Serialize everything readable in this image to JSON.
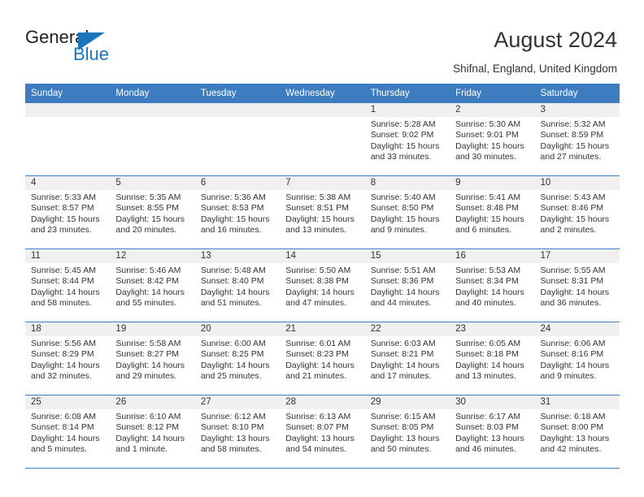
{
  "brand": {
    "name_part1": "General",
    "name_part2": "Blue"
  },
  "header": {
    "title": "August 2024",
    "location": "Shifnal, England, United Kingdom"
  },
  "colors": {
    "header_blue": "#3c7cbf",
    "brand_blue": "#1b75bb",
    "daynum_bg": "#f0f0f0",
    "text": "#333333"
  },
  "weekday_headers": [
    "Sunday",
    "Monday",
    "Tuesday",
    "Wednesday",
    "Thursday",
    "Friday",
    "Saturday"
  ],
  "weeks": [
    [
      {
        "day": "",
        "empty": true
      },
      {
        "day": "",
        "empty": true
      },
      {
        "day": "",
        "empty": true
      },
      {
        "day": "",
        "empty": true
      },
      {
        "day": "1",
        "sunrise": "Sunrise: 5:28 AM",
        "sunset": "Sunset: 9:02 PM",
        "daylight1": "Daylight: 15 hours",
        "daylight2": "and 33 minutes."
      },
      {
        "day": "2",
        "sunrise": "Sunrise: 5:30 AM",
        "sunset": "Sunset: 9:01 PM",
        "daylight1": "Daylight: 15 hours",
        "daylight2": "and 30 minutes."
      },
      {
        "day": "3",
        "sunrise": "Sunrise: 5:32 AM",
        "sunset": "Sunset: 8:59 PM",
        "daylight1": "Daylight: 15 hours",
        "daylight2": "and 27 minutes."
      }
    ],
    [
      {
        "day": "4",
        "sunrise": "Sunrise: 5:33 AM",
        "sunset": "Sunset: 8:57 PM",
        "daylight1": "Daylight: 15 hours",
        "daylight2": "and 23 minutes."
      },
      {
        "day": "5",
        "sunrise": "Sunrise: 5:35 AM",
        "sunset": "Sunset: 8:55 PM",
        "daylight1": "Daylight: 15 hours",
        "daylight2": "and 20 minutes."
      },
      {
        "day": "6",
        "sunrise": "Sunrise: 5:36 AM",
        "sunset": "Sunset: 8:53 PM",
        "daylight1": "Daylight: 15 hours",
        "daylight2": "and 16 minutes."
      },
      {
        "day": "7",
        "sunrise": "Sunrise: 5:38 AM",
        "sunset": "Sunset: 8:51 PM",
        "daylight1": "Daylight: 15 hours",
        "daylight2": "and 13 minutes."
      },
      {
        "day": "8",
        "sunrise": "Sunrise: 5:40 AM",
        "sunset": "Sunset: 8:50 PM",
        "daylight1": "Daylight: 15 hours",
        "daylight2": "and 9 minutes."
      },
      {
        "day": "9",
        "sunrise": "Sunrise: 5:41 AM",
        "sunset": "Sunset: 8:48 PM",
        "daylight1": "Daylight: 15 hours",
        "daylight2": "and 6 minutes."
      },
      {
        "day": "10",
        "sunrise": "Sunrise: 5:43 AM",
        "sunset": "Sunset: 8:46 PM",
        "daylight1": "Daylight: 15 hours",
        "daylight2": "and 2 minutes."
      }
    ],
    [
      {
        "day": "11",
        "sunrise": "Sunrise: 5:45 AM",
        "sunset": "Sunset: 8:44 PM",
        "daylight1": "Daylight: 14 hours",
        "daylight2": "and 58 minutes."
      },
      {
        "day": "12",
        "sunrise": "Sunrise: 5:46 AM",
        "sunset": "Sunset: 8:42 PM",
        "daylight1": "Daylight: 14 hours",
        "daylight2": "and 55 minutes."
      },
      {
        "day": "13",
        "sunrise": "Sunrise: 5:48 AM",
        "sunset": "Sunset: 8:40 PM",
        "daylight1": "Daylight: 14 hours",
        "daylight2": "and 51 minutes."
      },
      {
        "day": "14",
        "sunrise": "Sunrise: 5:50 AM",
        "sunset": "Sunset: 8:38 PM",
        "daylight1": "Daylight: 14 hours",
        "daylight2": "and 47 minutes."
      },
      {
        "day": "15",
        "sunrise": "Sunrise: 5:51 AM",
        "sunset": "Sunset: 8:36 PM",
        "daylight1": "Daylight: 14 hours",
        "daylight2": "and 44 minutes."
      },
      {
        "day": "16",
        "sunrise": "Sunrise: 5:53 AM",
        "sunset": "Sunset: 8:34 PM",
        "daylight1": "Daylight: 14 hours",
        "daylight2": "and 40 minutes."
      },
      {
        "day": "17",
        "sunrise": "Sunrise: 5:55 AM",
        "sunset": "Sunset: 8:31 PM",
        "daylight1": "Daylight: 14 hours",
        "daylight2": "and 36 minutes."
      }
    ],
    [
      {
        "day": "18",
        "sunrise": "Sunrise: 5:56 AM",
        "sunset": "Sunset: 8:29 PM",
        "daylight1": "Daylight: 14 hours",
        "daylight2": "and 32 minutes."
      },
      {
        "day": "19",
        "sunrise": "Sunrise: 5:58 AM",
        "sunset": "Sunset: 8:27 PM",
        "daylight1": "Daylight: 14 hours",
        "daylight2": "and 29 minutes."
      },
      {
        "day": "20",
        "sunrise": "Sunrise: 6:00 AM",
        "sunset": "Sunset: 8:25 PM",
        "daylight1": "Daylight: 14 hours",
        "daylight2": "and 25 minutes."
      },
      {
        "day": "21",
        "sunrise": "Sunrise: 6:01 AM",
        "sunset": "Sunset: 8:23 PM",
        "daylight1": "Daylight: 14 hours",
        "daylight2": "and 21 minutes."
      },
      {
        "day": "22",
        "sunrise": "Sunrise: 6:03 AM",
        "sunset": "Sunset: 8:21 PM",
        "daylight1": "Daylight: 14 hours",
        "daylight2": "and 17 minutes."
      },
      {
        "day": "23",
        "sunrise": "Sunrise: 6:05 AM",
        "sunset": "Sunset: 8:18 PM",
        "daylight1": "Daylight: 14 hours",
        "daylight2": "and 13 minutes."
      },
      {
        "day": "24",
        "sunrise": "Sunrise: 6:06 AM",
        "sunset": "Sunset: 8:16 PM",
        "daylight1": "Daylight: 14 hours",
        "daylight2": "and 9 minutes."
      }
    ],
    [
      {
        "day": "25",
        "sunrise": "Sunrise: 6:08 AM",
        "sunset": "Sunset: 8:14 PM",
        "daylight1": "Daylight: 14 hours",
        "daylight2": "and 5 minutes."
      },
      {
        "day": "26",
        "sunrise": "Sunrise: 6:10 AM",
        "sunset": "Sunset: 8:12 PM",
        "daylight1": "Daylight: 14 hours",
        "daylight2": "and 1 minute."
      },
      {
        "day": "27",
        "sunrise": "Sunrise: 6:12 AM",
        "sunset": "Sunset: 8:10 PM",
        "daylight1": "Daylight: 13 hours",
        "daylight2": "and 58 minutes."
      },
      {
        "day": "28",
        "sunrise": "Sunrise: 6:13 AM",
        "sunset": "Sunset: 8:07 PM",
        "daylight1": "Daylight: 13 hours",
        "daylight2": "and 54 minutes."
      },
      {
        "day": "29",
        "sunrise": "Sunrise: 6:15 AM",
        "sunset": "Sunset: 8:05 PM",
        "daylight1": "Daylight: 13 hours",
        "daylight2": "and 50 minutes."
      },
      {
        "day": "30",
        "sunrise": "Sunrise: 6:17 AM",
        "sunset": "Sunset: 8:03 PM",
        "daylight1": "Daylight: 13 hours",
        "daylight2": "and 46 minutes."
      },
      {
        "day": "31",
        "sunrise": "Sunrise: 6:18 AM",
        "sunset": "Sunset: 8:00 PM",
        "daylight1": "Daylight: 13 hours",
        "daylight2": "and 42 minutes."
      }
    ]
  ]
}
